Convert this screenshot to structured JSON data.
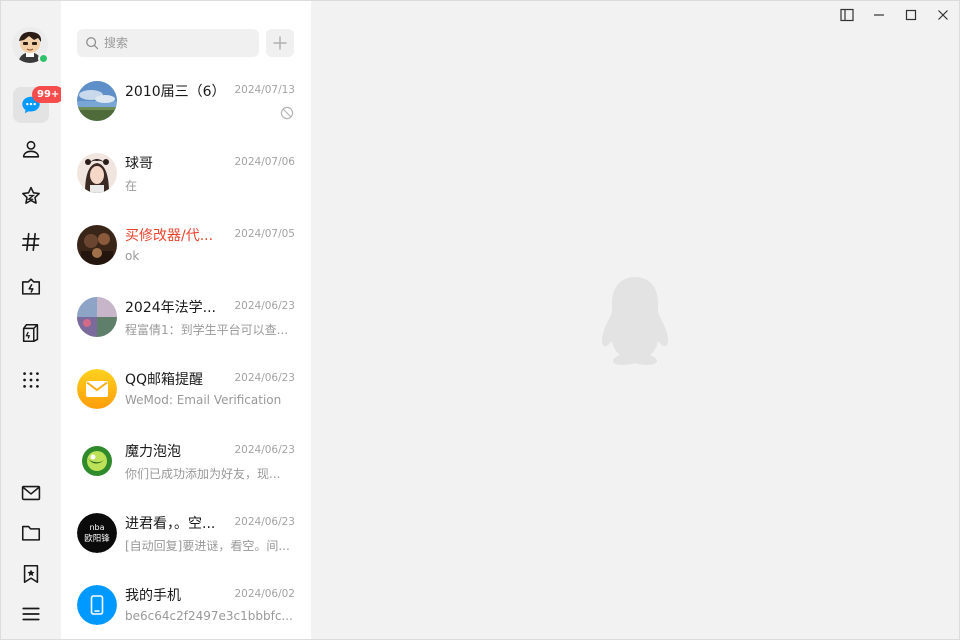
{
  "search": {
    "placeholder": "搜索"
  },
  "nav": {
    "messages_badge": "99+"
  },
  "conversations": [
    {
      "name": "2010届三（6）",
      "time": "2024/07/13",
      "message": "",
      "muted": true,
      "highlight": false
    },
    {
      "name": "球哥",
      "time": "2024/07/06",
      "message": "在",
      "muted": false,
      "highlight": false
    },
    {
      "name": "买修改器/代...",
      "time": "2024/07/05",
      "message": "ok",
      "muted": false,
      "highlight": true
    },
    {
      "name": "2024年法学...",
      "time": "2024/06/23",
      "message": "程富倩1：到学生平台可以查...",
      "muted": false,
      "highlight": false
    },
    {
      "name": "QQ邮箱提醒",
      "time": "2024/06/23",
      "message": "WeMod: Email Verification",
      "muted": false,
      "highlight": false
    },
    {
      "name": "魔力泡泡",
      "time": "2024/06/23",
      "message": "你们已成功添加为好友，现...",
      "muted": false,
      "highlight": false
    },
    {
      "name": "进君看，。空...",
      "time": "2024/06/23",
      "message": "[自动回复]要进谜，看空。间...",
      "muted": false,
      "highlight": false
    },
    {
      "name": "我的手机",
      "time": "2024/06/02",
      "message": "be6c64c2f2497e3c1bbbfc...",
      "muted": false,
      "highlight": false
    }
  ],
  "avatar_texts": {
    "nba_top": "nba",
    "nba_bottom": "欧阳锋"
  },
  "colors": {
    "accent": "#0099ff",
    "badge": "#f74c4c",
    "online": "#2ec26b",
    "highlight_name": "#e9452f"
  }
}
